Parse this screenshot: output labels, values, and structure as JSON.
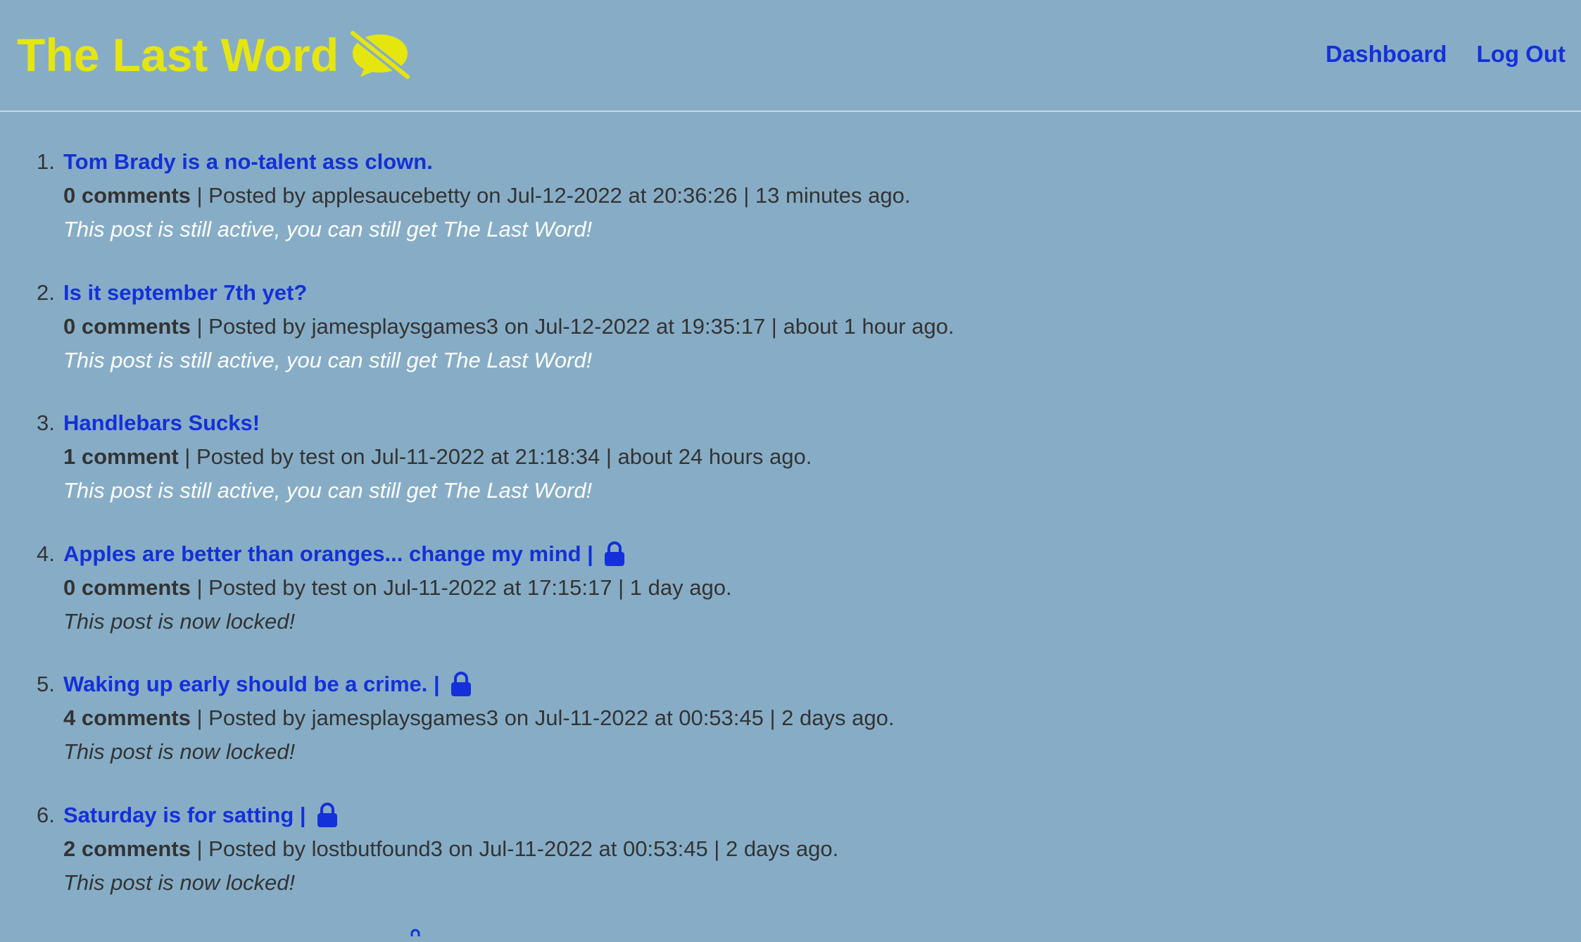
{
  "header": {
    "brand": "The Last Word",
    "brand_icon": "muted-speech-bubble-icon",
    "brand_color": "#e6e60f",
    "nav": [
      {
        "label": "Dashboard"
      },
      {
        "label": "Log Out"
      }
    ]
  },
  "colors": {
    "background": "#87adc6",
    "link": "#1430d8",
    "text": "#333333",
    "active_status": "#ffffff"
  },
  "posts": [
    {
      "number": "1.",
      "title": "Tom Brady is a no-talent ass clown.",
      "locked": false,
      "comments": "0 comments",
      "meta": " | Posted by applesaucebetty on Jul-12-2022 at 20:36:26 | 13 minutes ago.",
      "status": "This post is still active, you can still get The Last Word!"
    },
    {
      "number": "2.",
      "title": "Is it september 7th yet?",
      "locked": false,
      "comments": "0 comments",
      "meta": " | Posted by jamesplaysgames3 on Jul-12-2022 at 19:35:17 | about 1 hour ago.",
      "status": "This post is still active, you can still get The Last Word!"
    },
    {
      "number": "3.",
      "title": "Handlebars Sucks!",
      "locked": false,
      "comments": "1 comment",
      "meta": " | Posted by test on Jul-11-2022 at 21:18:34 | about 24 hours ago.",
      "status": "This post is still active, you can still get The Last Word!"
    },
    {
      "number": "4.",
      "title": "Apples are better than oranges... change my mind |",
      "locked": true,
      "comments": "0 comments",
      "meta": " | Posted by test on Jul-11-2022 at 17:15:17 | 1 day ago.",
      "status": "This post is now locked!"
    },
    {
      "number": "5.",
      "title": "Waking up early should be a crime. |",
      "locked": true,
      "comments": "4 comments",
      "meta": " | Posted by jamesplaysgames3 on Jul-11-2022 at 00:53:45 | 2 days ago.",
      "status": "This post is now locked!"
    },
    {
      "number": "6.",
      "title": "Saturday is for satting |",
      "locked": true,
      "comments": "2 comments",
      "meta": " | Posted by lostbutfound3 on Jul-11-2022 at 00:53:45 | 2 days ago.",
      "status": "This post is now locked!"
    }
  ]
}
